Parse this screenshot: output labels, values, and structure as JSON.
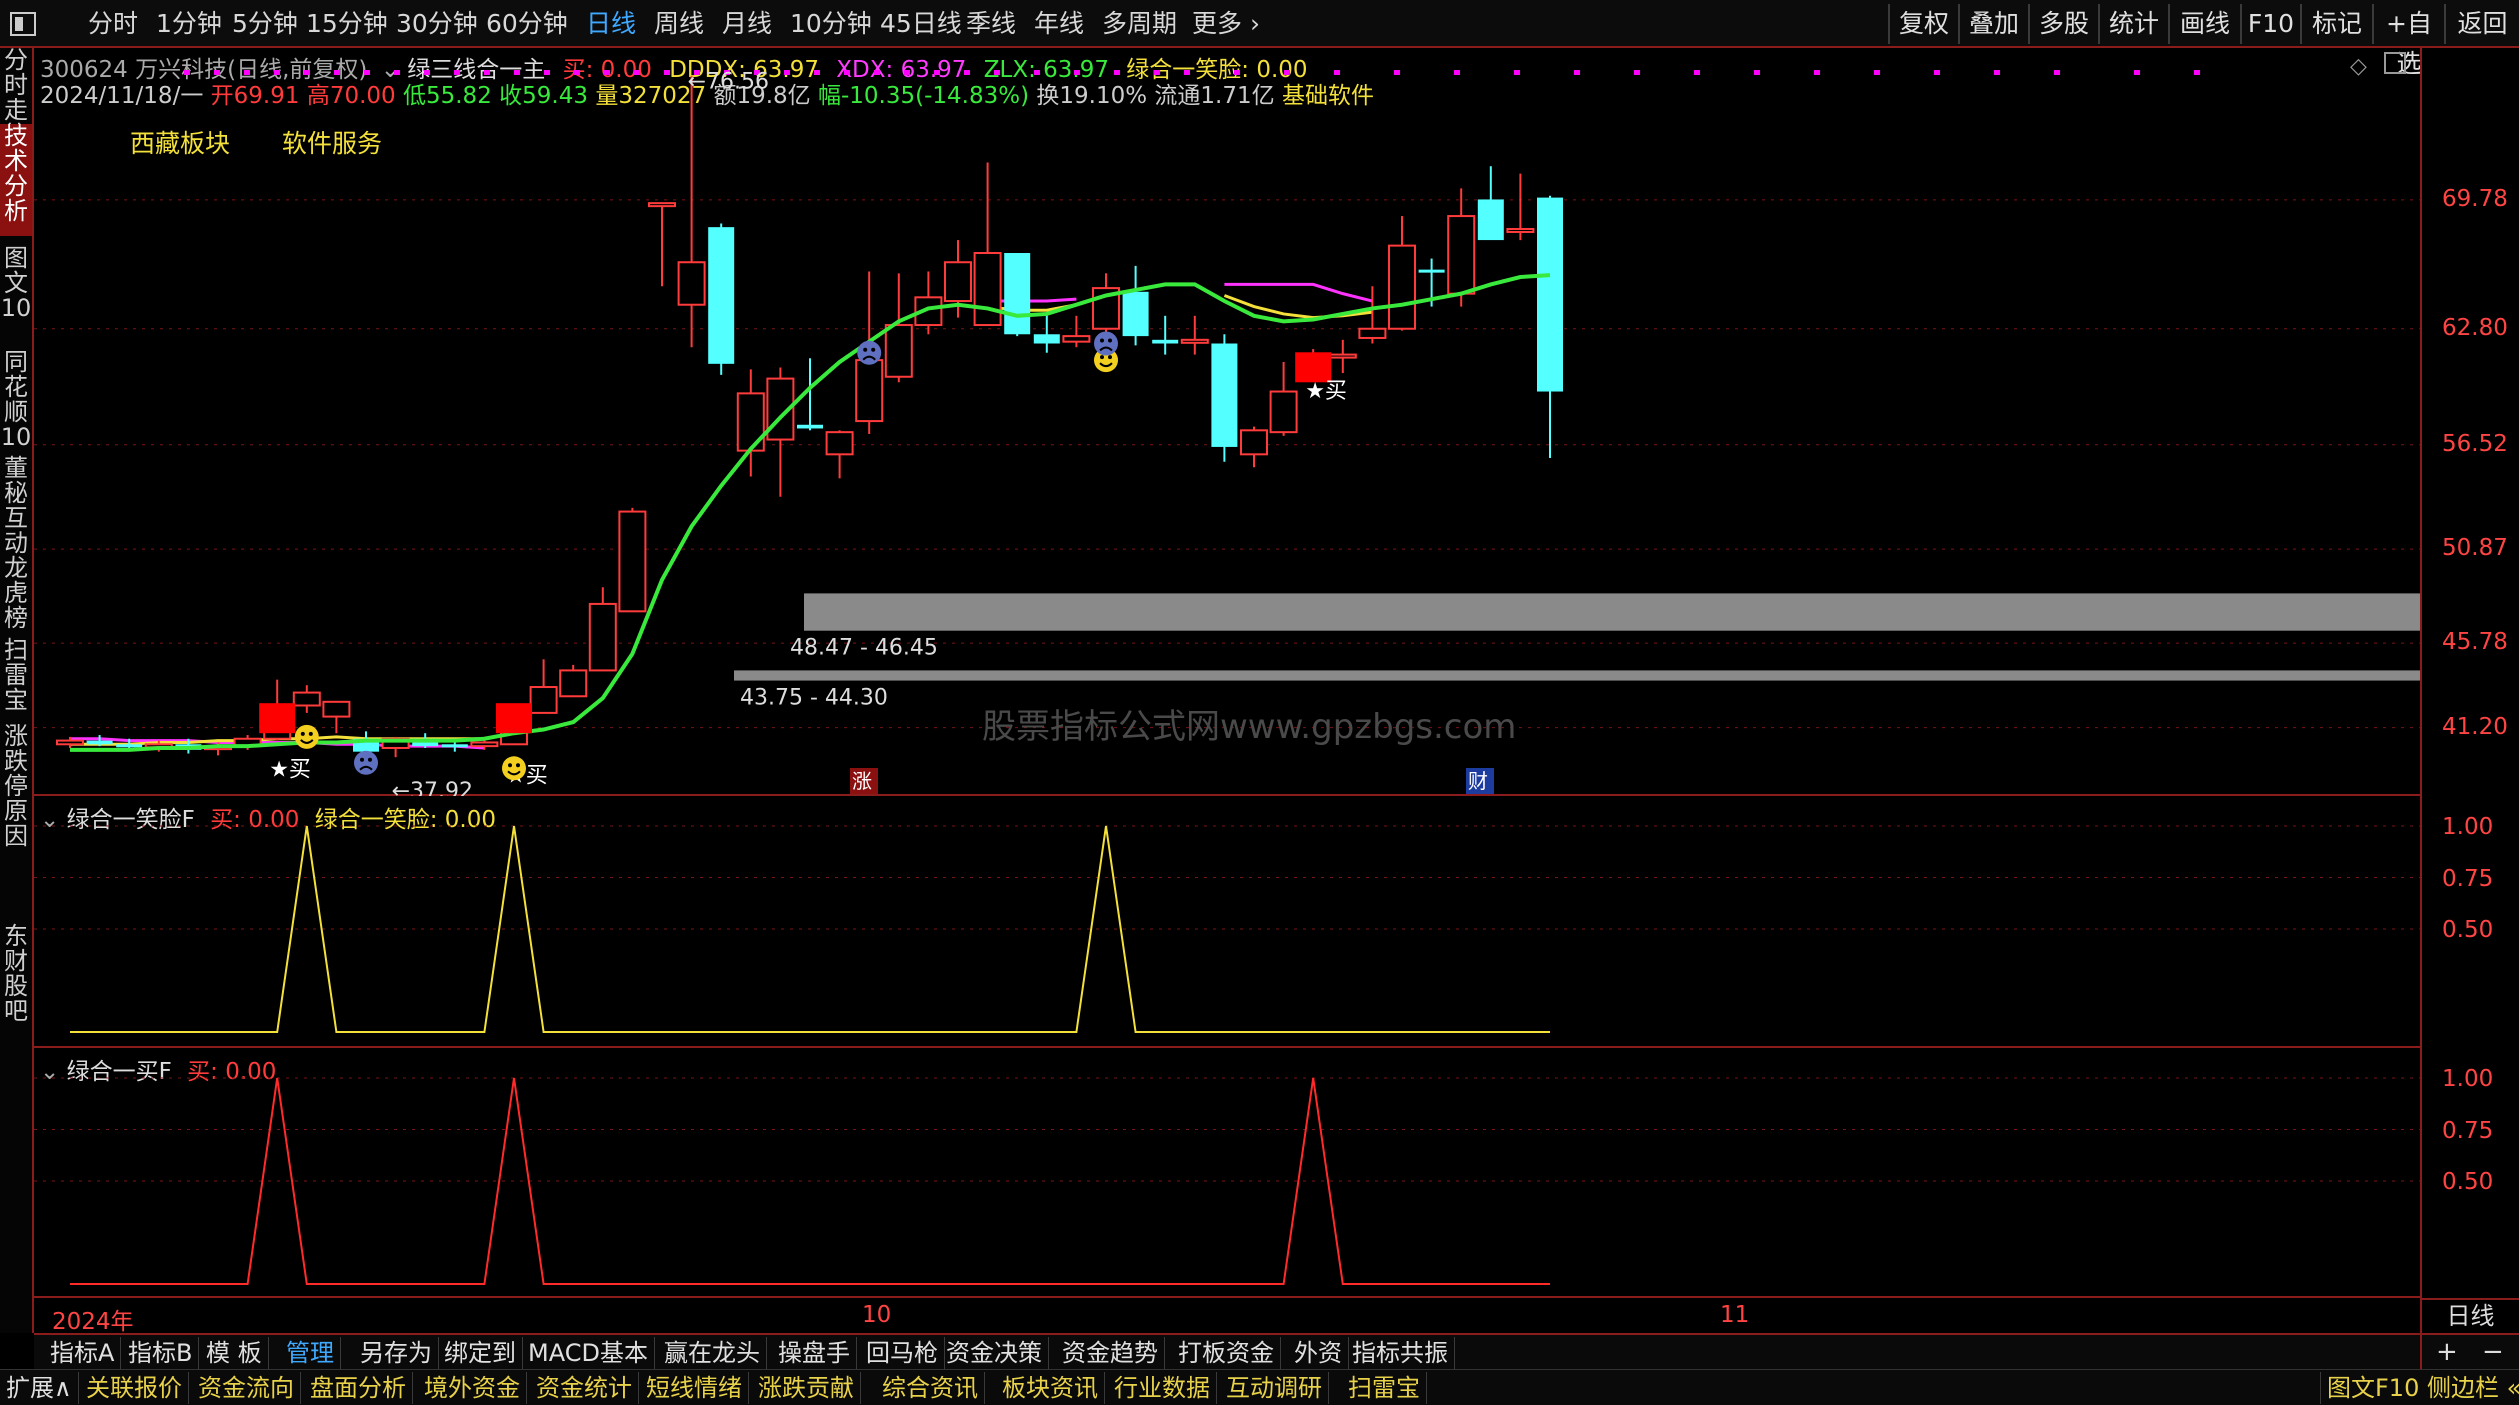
{
  "toolbar": {
    "periods": [
      "分时",
      "1分钟",
      "5分钟",
      "15分钟",
      "30分钟",
      "60分钟",
      "日线",
      "周线",
      "月线",
      "10分钟",
      "45日线",
      "季线",
      "年线",
      "多周期",
      "更多"
    ],
    "selected_period": "日线",
    "right_buttons": [
      "复权",
      "叠加",
      "多股",
      "统计",
      "画线",
      "F10",
      "标记",
      "+自选",
      "返回"
    ]
  },
  "side_tabs": [
    {
      "label": "分时走势",
      "selected": false
    },
    {
      "label": "技术分析",
      "selected": true
    },
    {
      "label": "图文10",
      "selected": false
    },
    {
      "label": "同花顺10",
      "selected": false
    },
    {
      "label": "董秘互动",
      "selected": false
    },
    {
      "label": "龙虎榜",
      "selected": false
    },
    {
      "label": "扫雷宝",
      "selected": false
    },
    {
      "label": "涨跌停原因",
      "selected": false
    },
    {
      "label": "东财股吧",
      "selected": false
    }
  ],
  "header": {
    "stock": "300624 万兴科技(日线,前复权)",
    "indicator": "绿三线合一主",
    "buy": "买: 0.00",
    "dddx": "DDDX: 63.97",
    "xdx": "XDX: 63.97",
    "zlx": "ZLX: 63.97",
    "smile": "绿合一笑脸: 0.00",
    "date": "2024/11/18/一",
    "open": "开69.91",
    "high": "高70.00",
    "low": "低55.82",
    "close": "收59.43",
    "volume": "量327027",
    "amount": "额19.8亿",
    "change": "幅-10.35(-14.83%)",
    "turnover": "换19.10%",
    "float_cap": "流通1.71亿",
    "sector": "基础软件",
    "tags": [
      "西藏板块",
      "软件服务"
    ]
  },
  "main_chart_labels": {
    "peak": "76.56",
    "low": "37.92",
    "zone_upper": "48.47 - 46.45",
    "zone_lower": "43.75 - 44.30",
    "buy_mark": "★买",
    "zhang": "涨",
    "cai": "财",
    "watermark": "股票指标公式网www.gpzbgs.com"
  },
  "axis": {
    "main_ticks": [
      "69.78",
      "62.80",
      "56.52",
      "50.87",
      "45.78",
      "41.20"
    ],
    "sub_ticks": [
      "1.00",
      "0.75",
      "0.50"
    ],
    "bottom_label": "日线",
    "zoom_in": "+",
    "zoom_out": "−",
    "x_labels": [
      "2024年",
      "10",
      "11"
    ]
  },
  "sub1": {
    "name": "绿合一笑脸F",
    "buy": "买: 0.00",
    "smile": "绿合一笑脸: 0.00"
  },
  "sub2": {
    "name": "绿合一买F",
    "buy": "买: 0.00"
  },
  "chart_data": {
    "type": "candlestick",
    "candles": [
      [
        40.3,
        40.7,
        40.1,
        40.5
      ],
      [
        40.5,
        40.8,
        40.2,
        40.3
      ],
      [
        40.3,
        40.6,
        40.0,
        40.2
      ],
      [
        40.2,
        40.5,
        39.9,
        40.3
      ],
      [
        40.3,
        40.6,
        39.8,
        40.0
      ],
      [
        40.1,
        40.4,
        39.7,
        40.2
      ],
      [
        40.2,
        40.8,
        40.0,
        40.6
      ],
      [
        40.6,
        43.8,
        40.5,
        42.2
      ],
      [
        42.4,
        43.5,
        42.0,
        43.1
      ],
      [
        41.8,
        42.5,
        40.9,
        42.6
      ],
      [
        40.6,
        41.0,
        39.8,
        39.9
      ],
      [
        40.1,
        40.7,
        39.6,
        40.6
      ],
      [
        40.6,
        40.9,
        40.1,
        40.2
      ],
      [
        40.3,
        40.6,
        39.9,
        40.2
      ],
      [
        40.2,
        40.7,
        40.0,
        40.4
      ],
      [
        40.3,
        42.5,
        40.3,
        42.2
      ],
      [
        42.0,
        44.9,
        42.0,
        43.4
      ],
      [
        42.9,
        44.6,
        42.9,
        44.3
      ],
      [
        44.3,
        48.8,
        44.3,
        47.9
      ],
      [
        47.5,
        53.1,
        47.5,
        52.9
      ],
      [
        69.6,
        69.6,
        65.1,
        69.6
      ],
      [
        64.1,
        76.5,
        61.8,
        66.4
      ],
      [
        68.3,
        68.5,
        60.3,
        60.9
      ],
      [
        56.2,
        60.6,
        54.8,
        59.3
      ],
      [
        56.8,
        60.7,
        53.7,
        60.1
      ],
      [
        57.6,
        61.2,
        57.3,
        57.4
      ],
      [
        56.0,
        57.3,
        54.7,
        57.2
      ],
      [
        57.8,
        65.9,
        57.1,
        61.1
      ],
      [
        60.2,
        65.8,
        59.9,
        63.0
      ],
      [
        63.0,
        65.9,
        62.5,
        64.5
      ],
      [
        64.3,
        67.6,
        63.4,
        66.4
      ],
      [
        63.0,
        71.8,
        63.0,
        66.9
      ],
      [
        66.9,
        66.9,
        62.4,
        62.5
      ],
      [
        62.5,
        63.7,
        61.5,
        62.0
      ],
      [
        62.1,
        63.5,
        61.8,
        62.4
      ],
      [
        62.8,
        65.8,
        62.4,
        65.0
      ],
      [
        64.8,
        66.2,
        61.9,
        62.4
      ],
      [
        62.2,
        63.5,
        61.4,
        62.0
      ],
      [
        62.1,
        63.5,
        61.4,
        62.2
      ],
      [
        62.0,
        62.5,
        55.6,
        56.4
      ],
      [
        56.0,
        57.5,
        55.3,
        57.3
      ],
      [
        57.2,
        61.0,
        57.0,
        59.4
      ],
      [
        61.1,
        61.7,
        60.5,
        61.2
      ],
      [
        61.4,
        62.2,
        60.4,
        61.4
      ],
      [
        62.3,
        65.1,
        62.0,
        62.8
      ],
      [
        62.8,
        68.9,
        62.7,
        67.3
      ],
      [
        66.0,
        66.6,
        64.0,
        65.9
      ],
      [
        64.7,
        70.4,
        64.0,
        68.9
      ],
      [
        69.8,
        71.6,
        68.3,
        67.6
      ],
      [
        68.2,
        71.2,
        67.6,
        68.2
      ],
      [
        69.9,
        70.0,
        55.8,
        59.4
      ]
    ],
    "lines": {
      "green": [
        40.0,
        40.0,
        40.0,
        40.1,
        40.1,
        40.2,
        40.2,
        40.3,
        40.4,
        40.4,
        40.5,
        40.5,
        40.5,
        40.5,
        40.6,
        40.9,
        41.1,
        41.5,
        42.8,
        45.2,
        49.2,
        52.1,
        54.3,
        56.3,
        58.0,
        59.6,
        61.0,
        62.1,
        63.2,
        63.9,
        64.1,
        63.9,
        63.5,
        63.6,
        64.1,
        64.6,
        64.9,
        65.2,
        65.2,
        64.3,
        63.5,
        63.2,
        63.3,
        63.6,
        63.9,
        64.1,
        64.4,
        64.7,
        65.2,
        65.6,
        65.7
      ],
      "yellow": [
        40.3,
        40.3,
        40.3,
        40.4,
        40.4,
        40.5,
        40.5,
        40.6,
        40.6,
        40.7,
        40.6,
        40.6,
        40.6,
        40.6,
        40.6,
        null,
        null,
        null,
        null,
        null,
        null,
        null,
        null,
        null,
        null,
        null,
        null,
        null,
        null,
        null,
        null,
        64.0,
        63.8,
        63.8,
        64.1,
        null,
        null,
        null,
        null,
        64.6,
        64.0,
        63.6,
        63.4,
        63.5,
        63.7,
        null,
        null,
        null,
        null,
        null,
        null
      ],
      "magenta": [
        40.6,
        40.6,
        40.5,
        40.5,
        40.5,
        40.4,
        40.4,
        40.4,
        40.4,
        40.3,
        40.3,
        40.2,
        40.2,
        40.2,
        40.1,
        null,
        null,
        null,
        null,
        null,
        null,
        null,
        null,
        null,
        null,
        null,
        null,
        null,
        null,
        null,
        null,
        64.3,
        64.3,
        64.3,
        64.4,
        null,
        null,
        null,
        null,
        65.2,
        65.2,
        65.2,
        65.2,
        64.7,
        64.3,
        null,
        null,
        null,
        null,
        null,
        null
      ]
    },
    "zones": [
      {
        "low": 46.45,
        "high": 48.47
      },
      {
        "low": 43.75,
        "high": 44.3
      }
    ],
    "buy_signals": [
      7,
      15,
      42
    ],
    "smile_signals": [
      8,
      15,
      35
    ],
    "ylim": [
      37.5,
      78
    ]
  }
}
